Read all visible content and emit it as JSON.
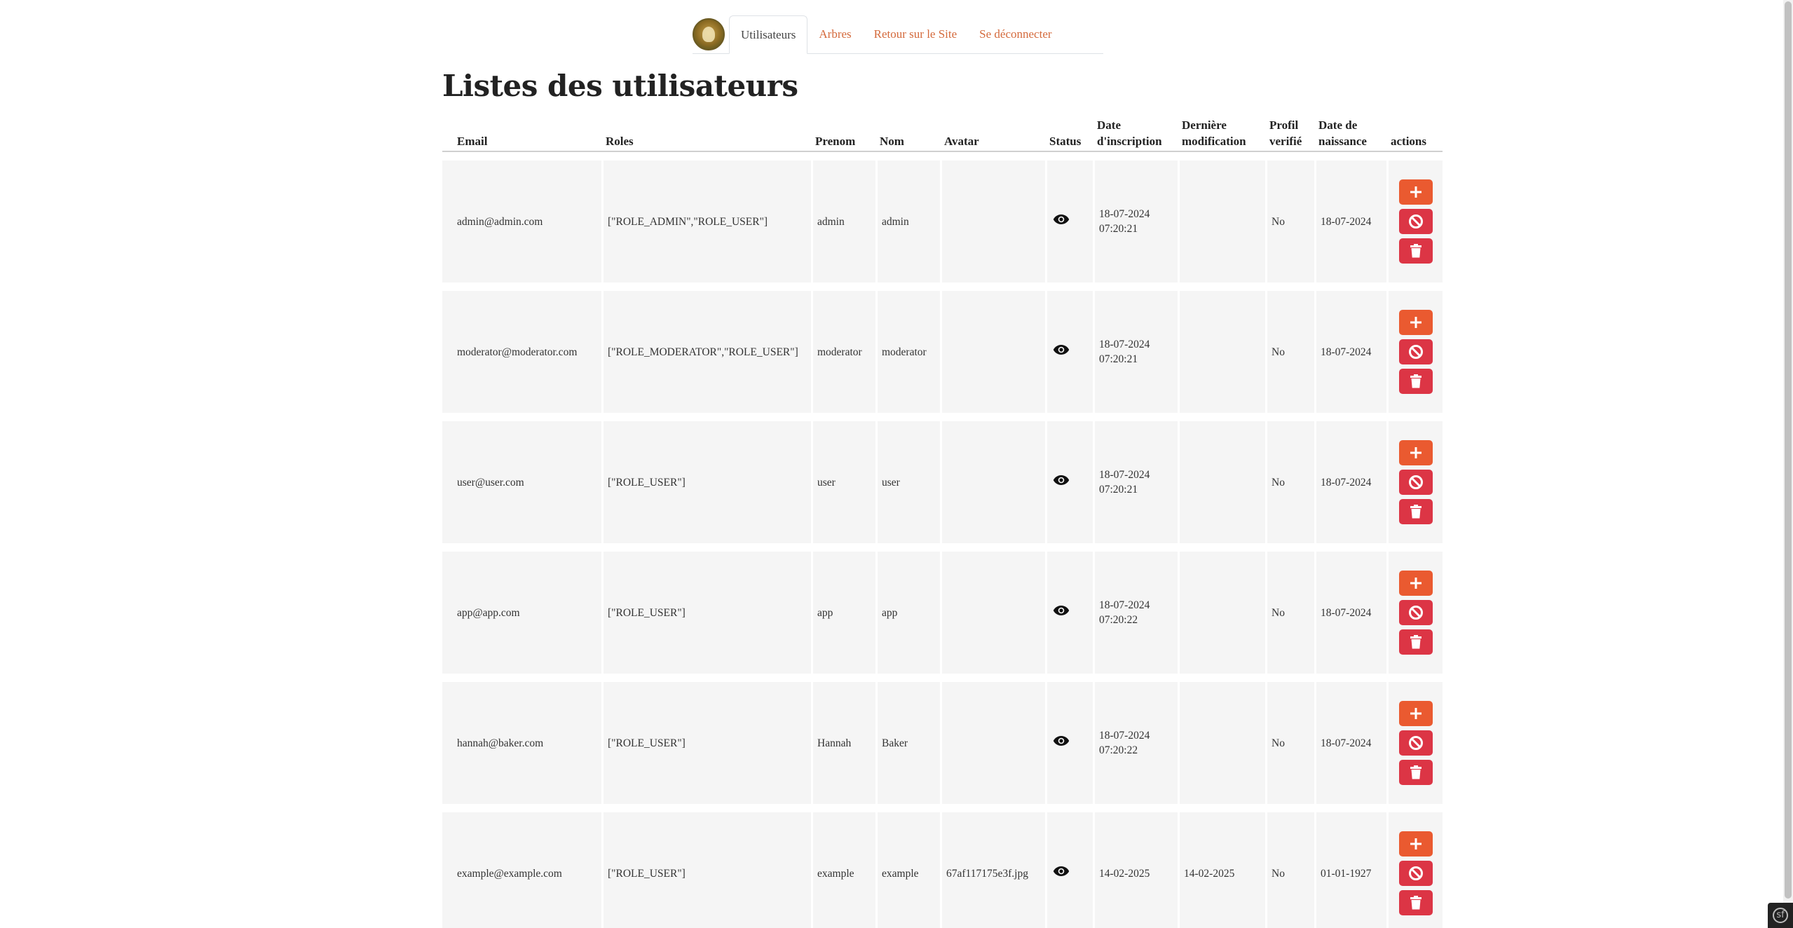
{
  "nav": {
    "logo_alt": "logo",
    "tabs": [
      {
        "label": "Utilisateurs",
        "active": true
      },
      {
        "label": "Arbres",
        "active": false
      },
      {
        "label": "Retour sur le Site",
        "active": false
      },
      {
        "label": "Se déconnecter",
        "active": false
      }
    ]
  },
  "page_title": "Listes des utilisateurs",
  "table": {
    "headers": {
      "email": "Email",
      "roles": "Roles",
      "prenom": "Prenom",
      "nom": "Nom",
      "avatar": "Avatar",
      "status": "Status",
      "date_inscription_1": "Date",
      "date_inscription_2": "d'inscription",
      "derniere_1": "Dernière",
      "derniere_2": "modification",
      "profil_1": "Profil",
      "profil_2": "verifié",
      "naissance_1": "Date de",
      "naissance_2": "naissance",
      "actions": "actions"
    },
    "rows": [
      {
        "email": "admin@admin.com",
        "roles": "[\"ROLE_ADMIN\",\"ROLE_USER\"]",
        "prenom": "admin",
        "nom": "admin",
        "avatar": "",
        "date_date": "18-07-2024",
        "date_time": "07:20:21",
        "mod_date": "",
        "mod_time": "",
        "profil": "No",
        "naissance": "18-07-2024"
      },
      {
        "email": "moderator@moderator.com",
        "roles": "[\"ROLE_MODERATOR\",\"ROLE_USER\"]",
        "prenom": "moderator",
        "nom": "moderator",
        "avatar": "",
        "date_date": "18-07-2024",
        "date_time": "07:20:21",
        "mod_date": "",
        "mod_time": "",
        "profil": "No",
        "naissance": "18-07-2024"
      },
      {
        "email": "user@user.com",
        "roles": "[\"ROLE_USER\"]",
        "prenom": "user",
        "nom": "user",
        "avatar": "",
        "date_date": "18-07-2024",
        "date_time": "07:20:21",
        "mod_date": "",
        "mod_time": "",
        "profil": "No",
        "naissance": "18-07-2024"
      },
      {
        "email": "app@app.com",
        "roles": "[\"ROLE_USER\"]",
        "prenom": "app",
        "nom": "app",
        "avatar": "",
        "date_date": "18-07-2024",
        "date_time": "07:20:22",
        "mod_date": "",
        "mod_time": "",
        "profil": "No",
        "naissance": "18-07-2024"
      },
      {
        "email": "hannah@baker.com",
        "roles": "[\"ROLE_USER\"]",
        "prenom": "Hannah",
        "nom": "Baker",
        "avatar": "",
        "date_date": "18-07-2024",
        "date_time": "07:20:22",
        "mod_date": "",
        "mod_time": "",
        "profil": "No",
        "naissance": "18-07-2024"
      },
      {
        "email": "example@example.com",
        "roles": "[\"ROLE_USER\"]",
        "prenom": "example",
        "nom": "example",
        "avatar": "67af117175e3f.jpg",
        "date_date": "14-02-2025",
        "date_time": "",
        "mod_date": "14-02-2025",
        "mod_time": "",
        "profil": "No",
        "naissance": "01-01-1927"
      }
    ]
  },
  "icons": {
    "status": "eye-icon",
    "add": "plus-icon",
    "ban": "ban-icon",
    "delete": "trash-icon"
  },
  "colors": {
    "accent": "#ea5a30",
    "danger": "#dc3545",
    "nav_link": "#d46a3c",
    "row_bg": "#f5f5f5"
  }
}
